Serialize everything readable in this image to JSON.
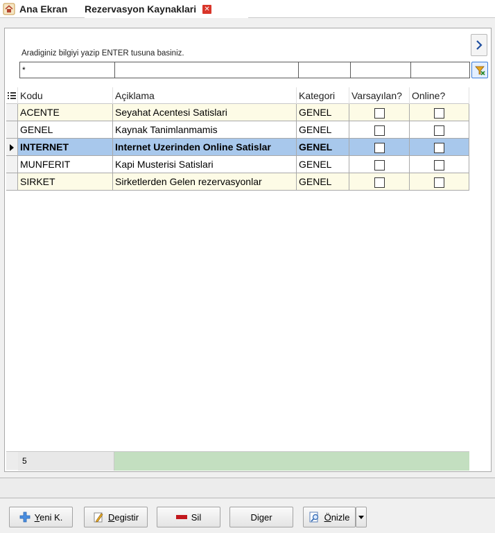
{
  "tabs": [
    {
      "label": "Ana Ekran",
      "active": false
    },
    {
      "label": "Rezervasyon Kaynaklari",
      "active": true
    }
  ],
  "search": {
    "hint": "Aradiginiz bilgiyi yazip ENTER tusuna basiniz.",
    "filters": [
      "*",
      "",
      "",
      "",
      ""
    ]
  },
  "grid": {
    "columns": [
      "Kodu",
      "Açiklama",
      "Kategori",
      "Varsayılan?",
      "Online?"
    ],
    "rows": [
      {
        "kodu": "ACENTE",
        "aciklama": "Seyahat Acentesi Satislari",
        "kategori": "GENEL",
        "varsayilan": false,
        "online": false
      },
      {
        "kodu": "GENEL",
        "aciklama": "Kaynak Tanimlanmamis",
        "kategori": "GENEL",
        "varsayilan": false,
        "online": false
      },
      {
        "kodu": "INTERNET",
        "aciklama": "Internet Uzerinden Online Satislar",
        "kategori": "GENEL",
        "varsayilan": false,
        "online": false
      },
      {
        "kodu": "MUNFERIT",
        "aciklama": "Kapi Musterisi Satislari",
        "kategori": "GENEL",
        "varsayilan": false,
        "online": false
      },
      {
        "kodu": "SIRKET",
        "aciklama": "Sirketlerden Gelen rezervasyonlar",
        "kategori": "GENEL",
        "varsayilan": false,
        "online": false
      }
    ],
    "selected_row": 2,
    "record_count": "5"
  },
  "toolbar": {
    "new_label": "Yeni K.",
    "edit_label": "Degistir",
    "delete_label": "Sil",
    "other_label": "Diger",
    "preview_label": "Önizle"
  },
  "colors": {
    "selected_row": "#a8c8ec",
    "odd_row": "#fdfbe6",
    "footer_green": "#c3dfc0",
    "close_red": "#d9352a",
    "accent_blue": "#3b7bd6"
  }
}
